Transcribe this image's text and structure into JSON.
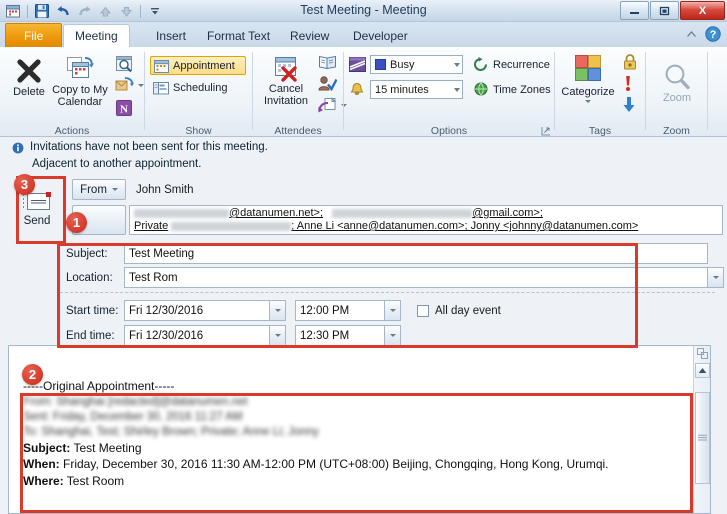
{
  "window": {
    "title": "Test Meeting  -  Meeting",
    "minimize_label": "—",
    "maximize_label": "▣",
    "close_label": "X"
  },
  "quick_access": [
    {
      "name": "calendar-icon",
      "label": ""
    },
    {
      "name": "save-icon",
      "label": ""
    },
    {
      "name": "undo-icon",
      "label": ""
    },
    {
      "name": "redo-icon",
      "label": ""
    },
    {
      "name": "previous-item-icon",
      "label": ""
    },
    {
      "name": "next-item-icon",
      "label": ""
    },
    {
      "name": "customize-qat-icon",
      "label": ""
    }
  ],
  "tabs": [
    {
      "label": "File",
      "active": false
    },
    {
      "label": "Meeting",
      "active": true
    },
    {
      "label": "Insert",
      "active": false
    },
    {
      "label": "Format Text",
      "active": false
    },
    {
      "label": "Review",
      "active": false
    },
    {
      "label": "Developer",
      "active": false
    }
  ],
  "help": {
    "minimize_ribbon": "minimize-ribbon-icon",
    "help": "help-icon",
    "help_glyph": "?"
  },
  "ribbon": {
    "groups": [
      {
        "label": "Actions",
        "buttons": [
          {
            "label": "Delete",
            "icon": "delete-x-icon"
          },
          {
            "label": "Copy to My Calendar",
            "icon": "copy-calendar-icon"
          },
          {
            "label": "",
            "icon": "find-related-icon"
          },
          {
            "label": "",
            "icon": "forward-icon"
          },
          {
            "label": "",
            "icon": "onenote-icon"
          }
        ]
      },
      {
        "label": "Show",
        "buttons": [
          {
            "label": "Appointment",
            "icon": "appointment-icon",
            "selected": true
          },
          {
            "label": "Scheduling",
            "icon": "scheduling-icon",
            "selected": false
          }
        ]
      },
      {
        "label": "Attendees",
        "buttons": [
          {
            "label": "Cancel Invitation",
            "icon": "cancel-invitation-icon"
          },
          {
            "label": "",
            "icon": "address-book-icon"
          },
          {
            "label": "",
            "icon": "check-names-icon"
          },
          {
            "label": "",
            "icon": "response-options-icon"
          }
        ]
      },
      {
        "label": "Options",
        "show_status": "Busy",
        "reminder": "15 minutes",
        "recurrence_label": "Recurrence",
        "timezones_label": "Time Zones",
        "dialog_launcher": "options-dialog-launcher"
      },
      {
        "label": "Tags",
        "categorize_label": "Categorize",
        "private_icon": "private-lock-icon",
        "high_importance_icon": "high-importance-icon",
        "low_importance_icon": "low-importance-icon"
      },
      {
        "label": "Zoom",
        "zoom_label": "Zoom"
      }
    ]
  },
  "infobar": {
    "line1": "Invitations have not been sent for this meeting.",
    "line2": "Adjacent to another appointment.",
    "icon": "info-icon"
  },
  "send_button": {
    "label": "Send",
    "icon": "send-envelope-icon"
  },
  "form": {
    "from_button": "From",
    "from_value": "John Smith",
    "to_line1_suffix": "@datanumen.net>;",
    "to_line1_suffix2": "@gmail.com>;",
    "to_line2_private": "Private",
    "to_line2_rest": "; Anne Li <anne@datanumen.com>; Jonny <johnny@datanumen.com>",
    "subject_label": "Subject:",
    "subject_value": "Test Meeting",
    "location_label": "Location:",
    "location_value": "Test Rom",
    "start_label": "Start time:",
    "start_date": "Fri 12/30/2016",
    "start_time": "12:00 PM",
    "end_label": "End time:",
    "end_date": "Fri 12/30/2016",
    "end_time": "12:30 PM",
    "allday_label": "All day event",
    "allday_checked": false
  },
  "body": {
    "separator": "-----Original Appointment-----",
    "redacted_line_from": "From: Shanghai   [redacted]@datanumen.net",
    "redacted_line_sent": "Sent: Friday, December 30, 2016 11:27 AM",
    "redacted_line_to": "To: Shanghai, Test; Shirley Brown; Private; Anne Li; Jonny",
    "subject_label": "Subject:",
    "subject_value": " Test Meeting",
    "when_label": "When:",
    "when_value": " Friday, December 30, 2016 11:30 AM-12:00 PM (UTC+08:00) Beijing, Chongqing, Hong Kong, Urumqi.",
    "where_label": "Where:",
    "where_value": " Test Room"
  },
  "scrollbar": {
    "split_handle": "split-pane-icon",
    "up_arrow": "scroll-up-icon",
    "thumb": "scroll-thumb"
  },
  "annotations": [
    {
      "number": "1",
      "target": "to-field"
    },
    {
      "number": "2",
      "target": "message-body"
    },
    {
      "number": "3",
      "target": "send-button"
    }
  ],
  "colors": {
    "accent_orange": "#ef9a0e",
    "annotation_red": "#d83a2c",
    "selected_gold": "#fbdd84",
    "busy_blue": "#3b4fc4"
  }
}
